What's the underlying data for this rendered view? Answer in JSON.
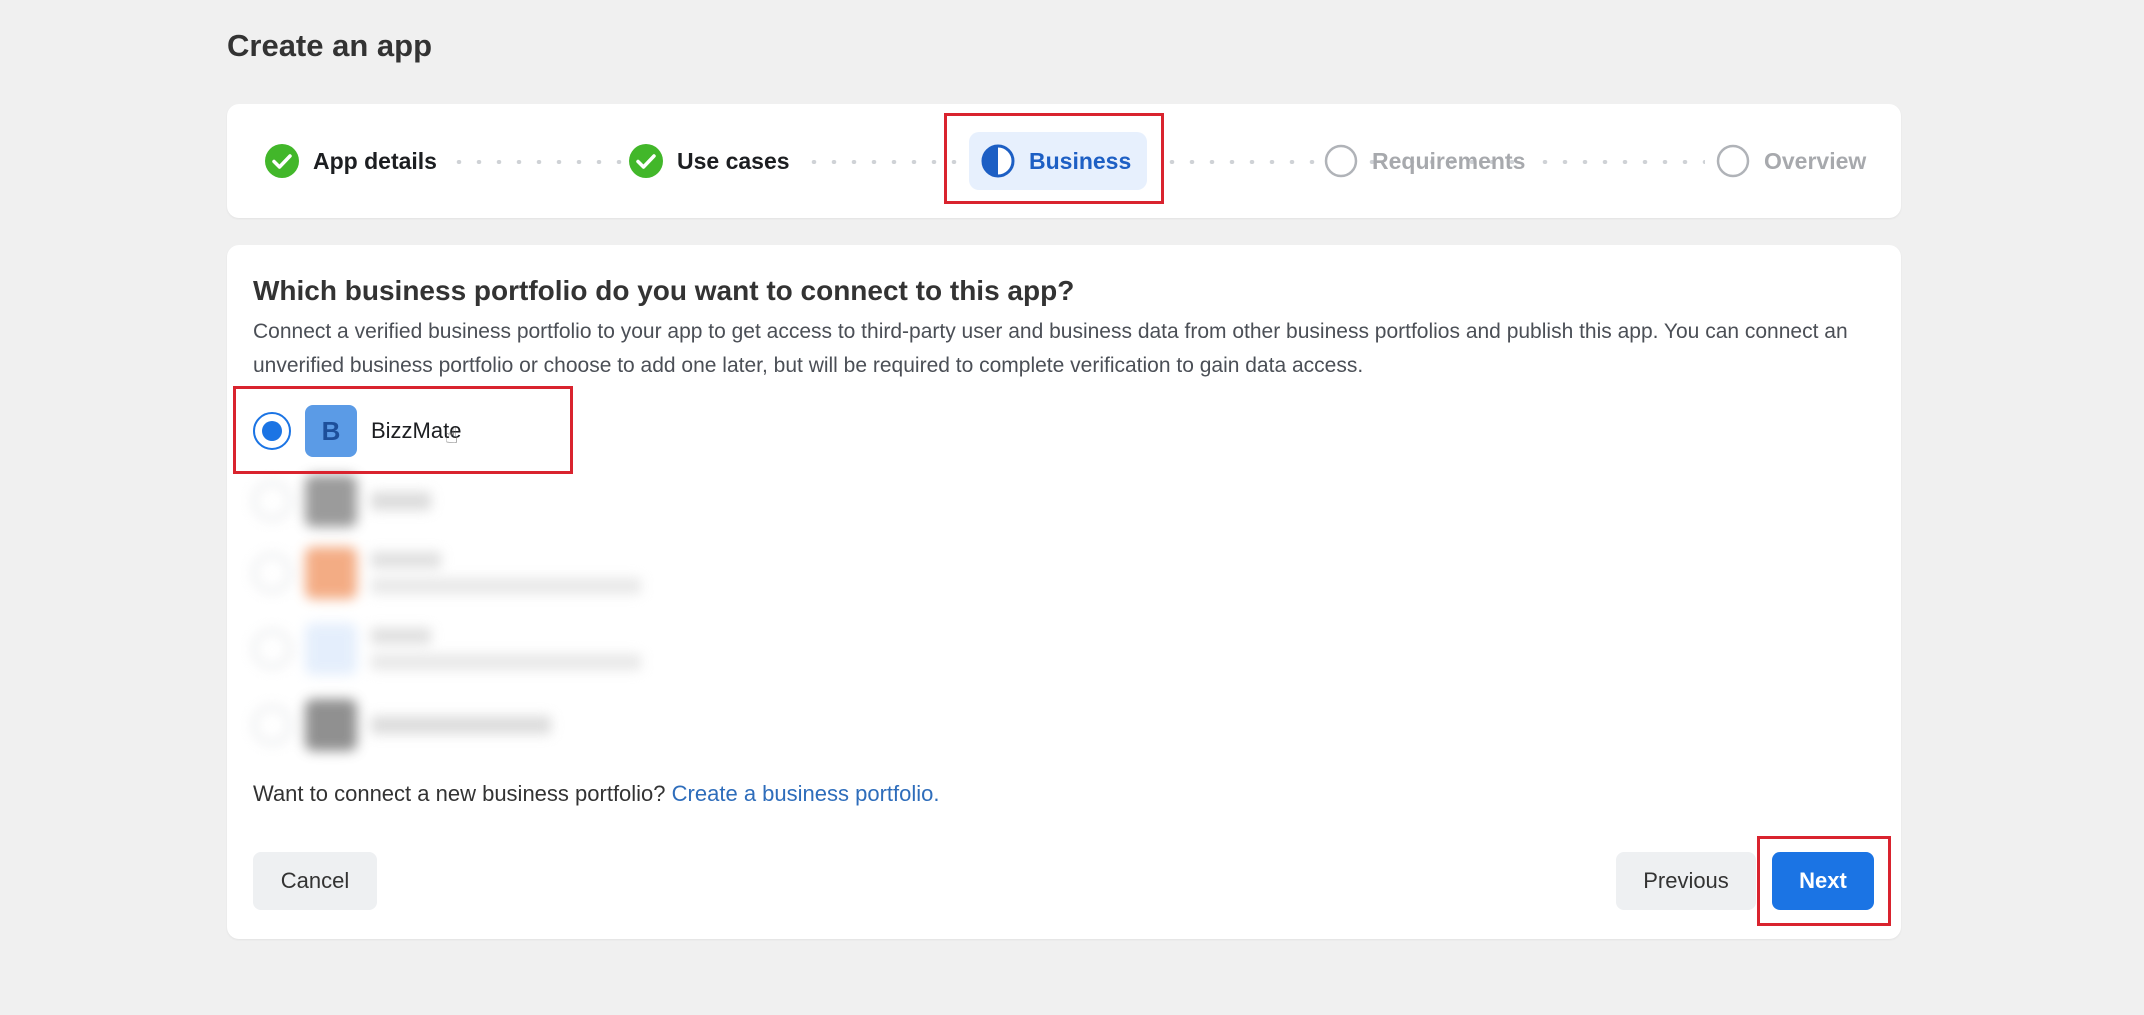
{
  "page": {
    "title": "Create an app"
  },
  "stepper": {
    "steps": [
      {
        "label": "App details",
        "state": "done",
        "icon": "check-circle-icon"
      },
      {
        "label": "Use cases",
        "state": "done",
        "icon": "check-circle-icon"
      },
      {
        "label": "Business",
        "state": "active",
        "icon": "half-circle-icon"
      },
      {
        "label": "Requirements",
        "state": "todo",
        "icon": "empty-circle-icon"
      },
      {
        "label": "Overview",
        "state": "todo",
        "icon": "empty-circle-icon"
      }
    ]
  },
  "portfolio": {
    "question": "Which business portfolio do you want to connect to this app?",
    "description": "Connect a verified business portfolio to your app to get access to third-party user and business data from other business portfolios and publish this app. You can connect an unverified business portfolio or choose to add one later, but will be required to complete verification to gain data access.",
    "options": [
      {
        "name": "BizzMate",
        "initial": "B",
        "selected": true
      }
    ],
    "connect_prompt": "Want to connect a new business portfolio?",
    "connect_link": "Create a business portfolio."
  },
  "actions": {
    "cancel_label": "Cancel",
    "previous_label": "Previous",
    "next_label": "Next"
  },
  "colors": {
    "accent": "#1b74e4",
    "success": "#42b72a",
    "highlight": "#d9232e",
    "active_pill": "#e7f0fd"
  }
}
